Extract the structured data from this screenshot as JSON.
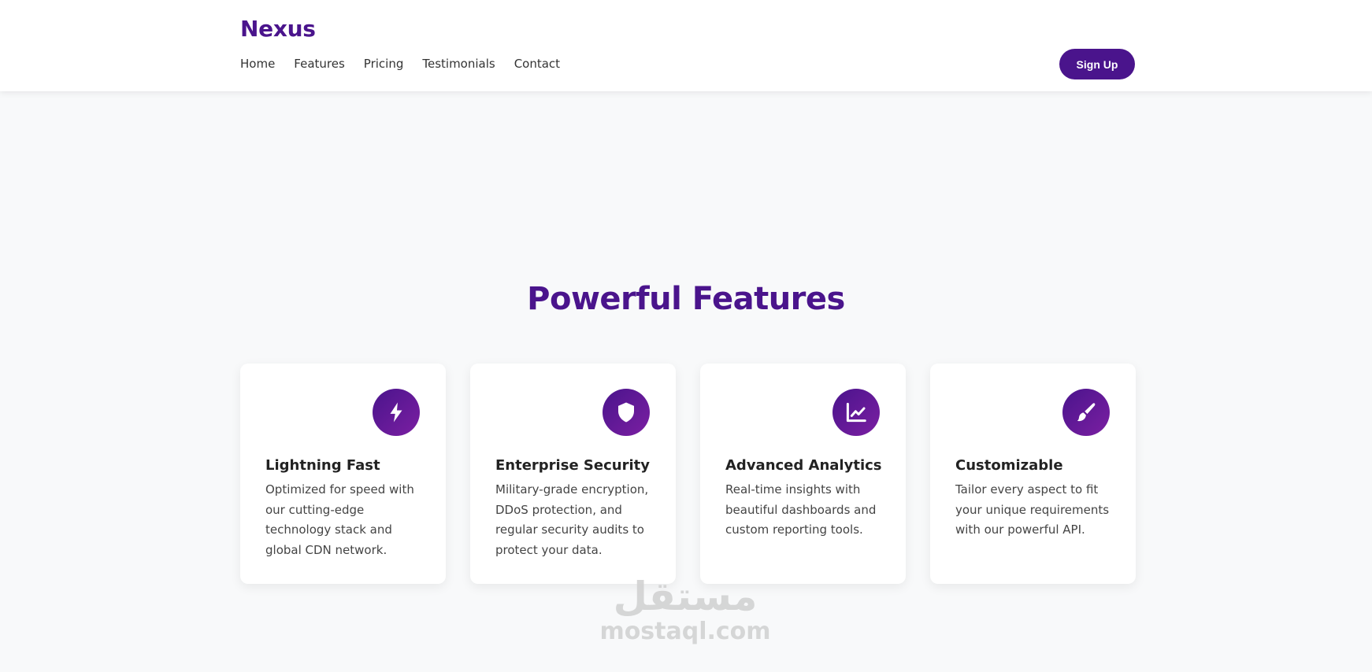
{
  "header": {
    "logo": "Nexus",
    "nav": [
      "Home",
      "Features",
      "Pricing",
      "Testimonials",
      "Contact"
    ],
    "signup_label": "Sign Up"
  },
  "features": {
    "title": "Powerful Features",
    "cards": [
      {
        "icon": "lightning-icon",
        "title": "Lightning Fast",
        "description": "Optimized for speed with our cutting-edge technology stack and global CDN network."
      },
      {
        "icon": "shield-icon",
        "title": "Enterprise Security",
        "description": "Military-grade encryption, DDoS protection, and regular security audits to protect your data."
      },
      {
        "icon": "chart-line-icon",
        "title": "Advanced Analytics",
        "description": "Real-time insights with beautiful dashboards and custom reporting tools."
      },
      {
        "icon": "paintbrush-icon",
        "title": "Customizable",
        "description": "Tailor every aspect to fit your unique requirements with our powerful API."
      }
    ]
  },
  "watermark": {
    "arabic": "مستقل",
    "latin": "mostaql.com"
  },
  "colors": {
    "brand": "#4a148c",
    "background": "#f8f9fa"
  }
}
